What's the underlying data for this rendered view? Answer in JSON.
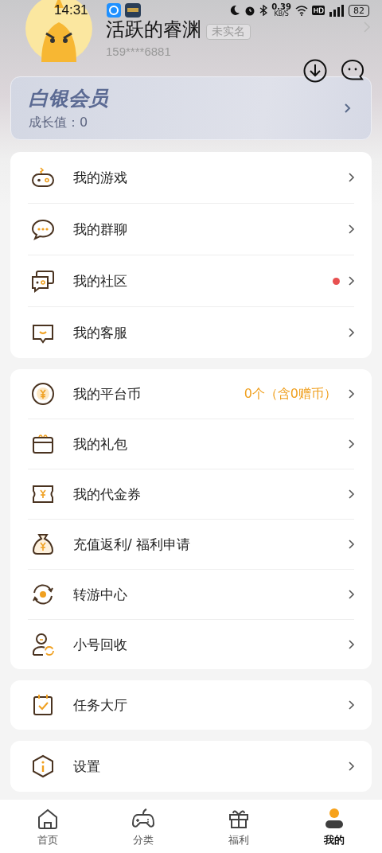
{
  "status_bar": {
    "time": "14:31",
    "speed": "0.39",
    "speed_unit": "KB/S",
    "battery": "82"
  },
  "profile": {
    "name": "活跃的睿渊",
    "verify_badge": "未实名",
    "phone": "159****6881"
  },
  "member_card": {
    "title": "白银会员",
    "growth": "成长值：0"
  },
  "groups": [
    {
      "items": [
        {
          "label": "我的游戏",
          "dot": false
        },
        {
          "label": "我的群聊",
          "dot": false
        },
        {
          "label": "我的社区",
          "dot": true
        },
        {
          "label": "我的客服",
          "dot": false
        }
      ]
    },
    {
      "items": [
        {
          "label": "我的平台币",
          "dot": false,
          "value": "0个（含0赠币）"
        },
        {
          "label": "我的礼包",
          "dot": false
        },
        {
          "label": "我的代金券",
          "dot": false
        },
        {
          "label": "充值返利/ 福利申请",
          "dot": false
        },
        {
          "label": "转游中心",
          "dot": false
        },
        {
          "label": "小号回收",
          "dot": false
        }
      ]
    },
    {
      "items": [
        {
          "label": "任务大厅",
          "dot": false
        }
      ]
    },
    {
      "items": [
        {
          "label": "设置",
          "dot": false
        }
      ]
    }
  ],
  "tabs": [
    {
      "label": "首页",
      "selected": false
    },
    {
      "label": "分类",
      "selected": false
    },
    {
      "label": "福利",
      "selected": false
    },
    {
      "label": "我的",
      "selected": true
    }
  ]
}
